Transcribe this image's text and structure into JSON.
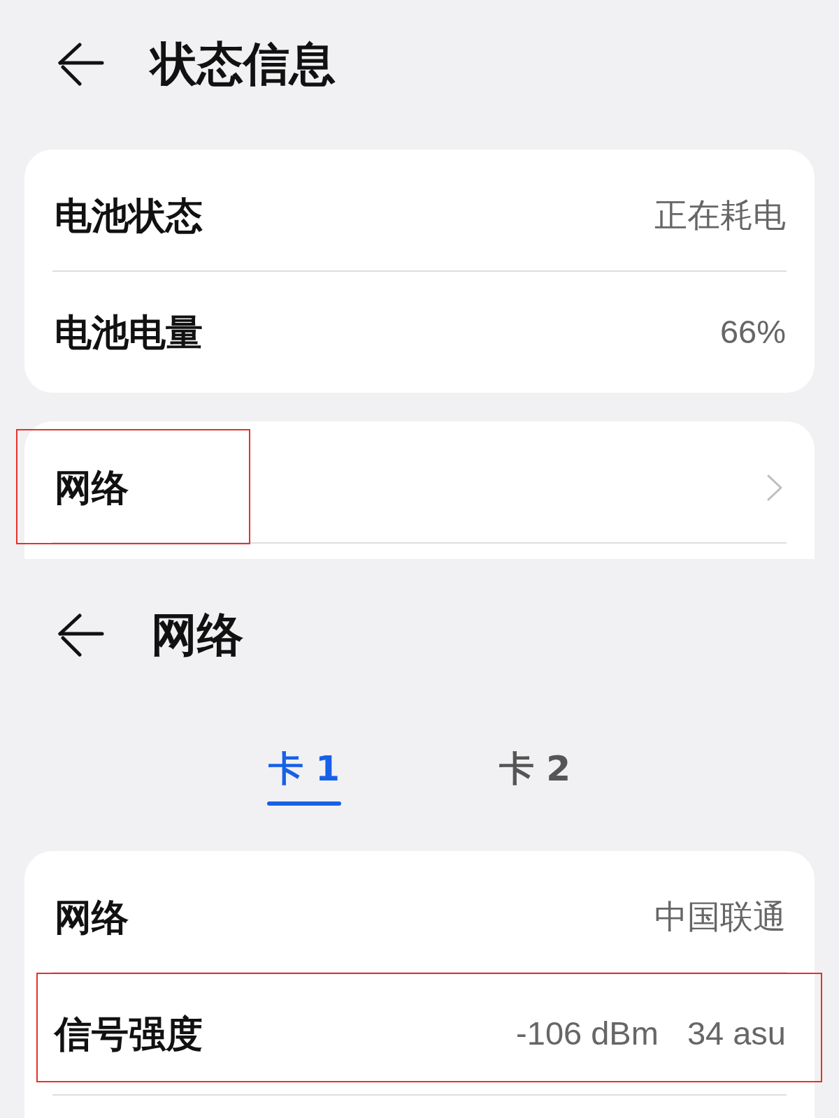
{
  "screens": [
    {
      "header": {
        "title": "状态信息"
      },
      "cards": [
        {
          "cut_off": false,
          "rows": [
            {
              "kind": "info",
              "label": "电池状态",
              "values": [
                "正在耗电"
              ],
              "label_framed": false,
              "row_framed": false
            },
            {
              "kind": "info",
              "label": "电池电量",
              "values": [
                "66%"
              ],
              "label_framed": false,
              "row_framed": false
            }
          ]
        },
        {
          "cut_off": true,
          "rows": [
            {
              "kind": "link",
              "label": "网络",
              "label_framed": true,
              "row_framed": false
            }
          ]
        }
      ]
    },
    {
      "header": {
        "title": "网络"
      },
      "tabs": [
        {
          "label": "卡 1",
          "selected": true
        },
        {
          "label": "卡 2",
          "selected": false
        }
      ],
      "cards": [
        {
          "cut_off": true,
          "rows": [
            {
              "kind": "info",
              "label": "网络",
              "values": [
                "中国联通"
              ],
              "label_framed": false,
              "row_framed": false
            },
            {
              "kind": "info",
              "label": "信号强度",
              "values": [
                "-106 dBm",
                "34 asu"
              ],
              "label_framed": false,
              "row_framed": true
            }
          ]
        }
      ]
    }
  ]
}
